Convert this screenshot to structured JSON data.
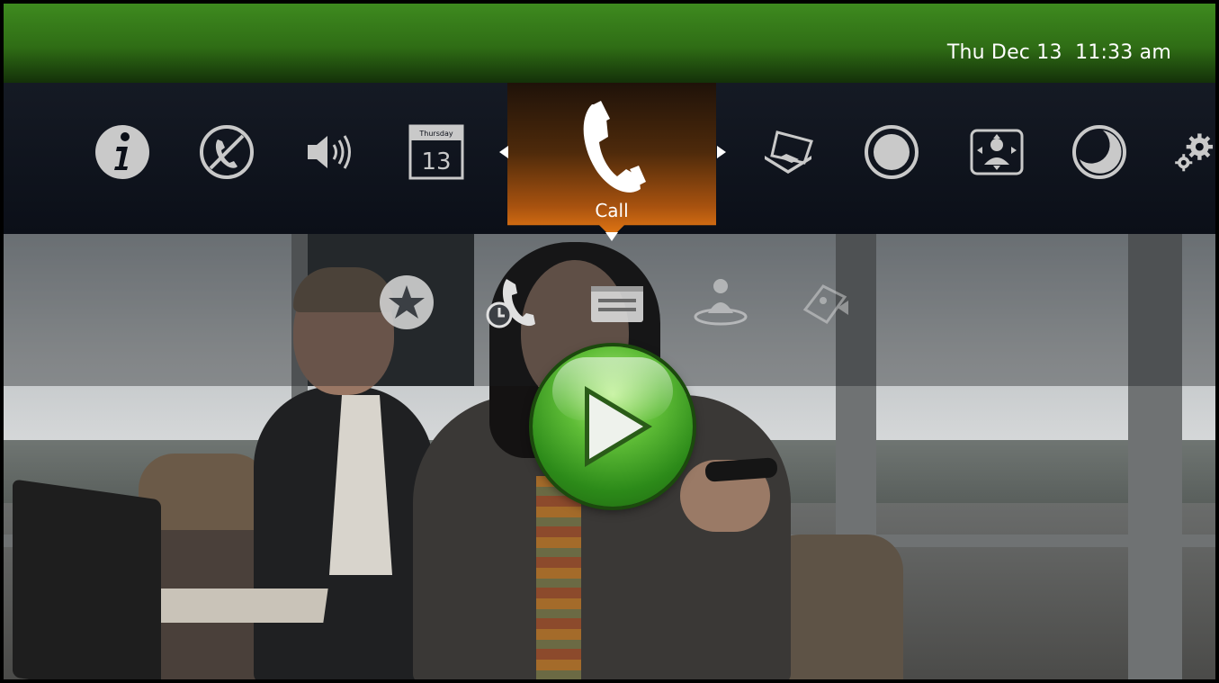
{
  "status_bar": {
    "date": "Thu Dec 13",
    "time": "11:33 am"
  },
  "main_menu": {
    "items": [
      {
        "name": "info",
        "icon": "info-icon"
      },
      {
        "name": "do-not-disturb",
        "icon": "no-call-icon"
      },
      {
        "name": "volume",
        "icon": "speaker-icon"
      },
      {
        "name": "calendar",
        "icon": "calendar-icon",
        "day_name": "Thursday",
        "day_number": "13"
      },
      {
        "name": "call",
        "icon": "phone-icon",
        "label": "Call",
        "selected": true
      },
      {
        "name": "presentation",
        "icon": "laptop-icon"
      },
      {
        "name": "record",
        "icon": "record-icon"
      },
      {
        "name": "camera-control",
        "icon": "camera-control-icon"
      },
      {
        "name": "standby",
        "icon": "moon-icon"
      },
      {
        "name": "settings",
        "icon": "gears-icon"
      }
    ]
  },
  "submenu": {
    "items": [
      {
        "name": "favorites",
        "icon": "star-icon"
      },
      {
        "name": "recent-calls",
        "icon": "recent-calls-icon"
      },
      {
        "name": "directory",
        "icon": "directory-icon"
      },
      {
        "name": "meetings",
        "icon": "people-icon"
      },
      {
        "name": "dial-pad",
        "icon": "dialpad-icon"
      }
    ]
  },
  "play_button": {
    "icon": "play-icon"
  },
  "colors": {
    "top_bar_green": "#2f6d15",
    "menu_background": "#0b0f18",
    "selected_orange": "#e87a14",
    "icon_gray": "#c8c8c8",
    "play_green": "#5fbd37"
  }
}
